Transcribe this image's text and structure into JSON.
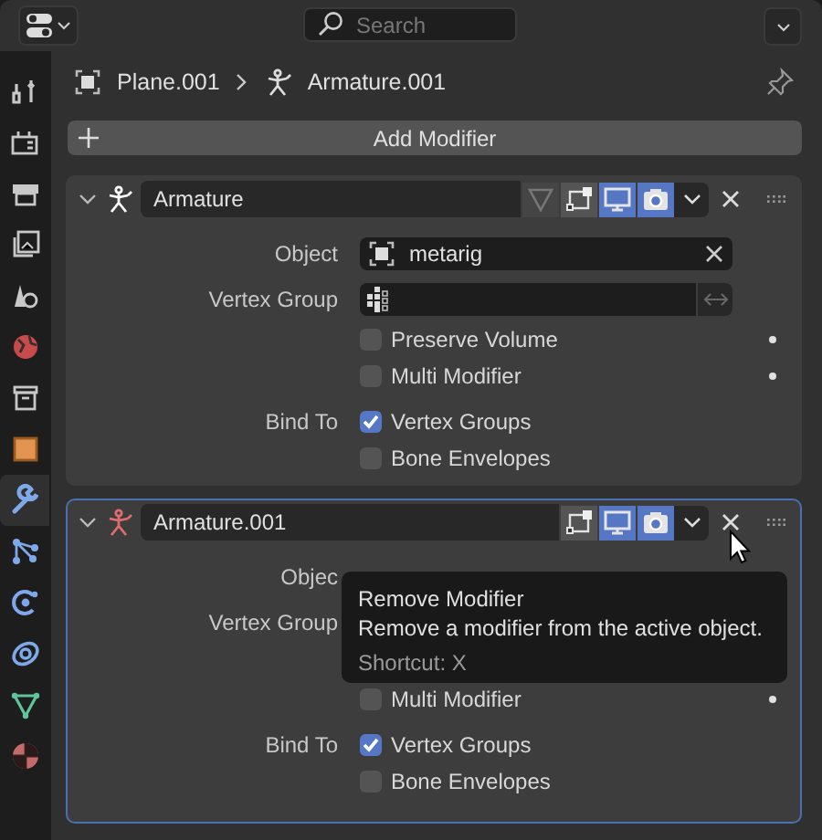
{
  "topbar": {
    "search": {
      "placeholder": "Search"
    }
  },
  "sidebar": {
    "tabs": [
      {
        "kind": "tool",
        "selected": false
      },
      {
        "kind": "render",
        "selected": false
      },
      {
        "kind": "output",
        "selected": false
      },
      {
        "kind": "view_layer",
        "selected": false
      },
      {
        "kind": "scene",
        "selected": false
      },
      {
        "kind": "world",
        "selected": false
      },
      {
        "kind": "collection",
        "selected": false
      },
      {
        "kind": "object",
        "selected": false
      },
      {
        "kind": "modifier",
        "selected": true
      },
      {
        "kind": "particles",
        "selected": false
      },
      {
        "kind": "physics",
        "selected": false
      },
      {
        "kind": "constraints",
        "selected": false
      },
      {
        "kind": "data",
        "selected": false
      },
      {
        "kind": "material",
        "selected": false
      }
    ]
  },
  "breadcrumb": [
    {
      "kind": "mesh",
      "label": "Plane.001"
    },
    {
      "kind": "armature",
      "label": "Armature.001"
    }
  ],
  "add_button": {
    "label": "Add Modifier"
  },
  "modifiers": [
    {
      "name": "Armature",
      "color": "#ffffff",
      "expanded": true,
      "active": false,
      "toggles": [
        {
          "kind": "cage",
          "disabled": true
        },
        {
          "kind": "editmode",
          "on": false,
          "disabled": false
        },
        {
          "kind": "viewport",
          "on": true,
          "disabled": false
        },
        {
          "kind": "render",
          "on": true,
          "disabled": false
        }
      ],
      "rows": [
        {
          "kind": "object",
          "label": "Object",
          "value": "metarig"
        },
        {
          "kind": "vgroup",
          "label": "Vertex Group"
        },
        {
          "kind": "check",
          "text": "Preserve Volume",
          "checked": false,
          "keyframe": true
        },
        {
          "kind": "check",
          "text": "Multi Modifier",
          "checked": false,
          "keyframe": true
        },
        {
          "kind": "check",
          "label": "Bind To",
          "text": "Vertex Groups",
          "checked": true,
          "keyframe": false
        },
        {
          "kind": "check",
          "text": "Bone Envelopes",
          "checked": false,
          "keyframe": false
        }
      ]
    },
    {
      "name": "Armature.001",
      "color": "#e06d6d",
      "expanded": true,
      "active": true,
      "toggles": [
        {
          "kind": "editmode",
          "on": false,
          "disabled": false
        },
        {
          "kind": "viewport",
          "on": true,
          "disabled": false
        },
        {
          "kind": "render",
          "on": true,
          "disabled": false
        }
      ],
      "rows": [
        {
          "kind": "covered",
          "label": "Objec"
        },
        {
          "kind": "covered",
          "label": "Vertex Group"
        },
        {
          "kind": "covered_check"
        },
        {
          "kind": "check",
          "text": "Multi Modifier",
          "checked": false,
          "keyframe": true
        },
        {
          "kind": "check",
          "label": "Bind To",
          "text": "Vertex Groups",
          "checked": true,
          "keyframe": false
        },
        {
          "kind": "check",
          "text": "Bone Envelopes",
          "checked": false,
          "keyframe": false
        }
      ]
    }
  ],
  "tooltip": {
    "title": "Remove Modifier",
    "description": "Remove a modifier from the active object.",
    "shortcut": "Shortcut: X"
  }
}
